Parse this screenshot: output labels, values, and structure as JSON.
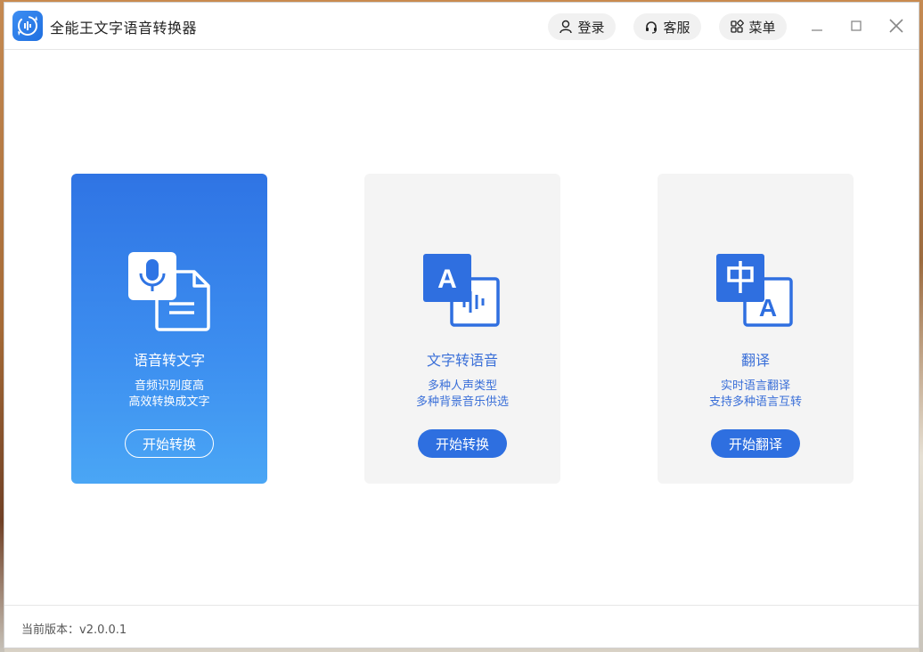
{
  "app": {
    "title": "全能王文字语音转换器",
    "logo_icon": "refresh-sound-icon",
    "accent": "#2e6fe0"
  },
  "header": {
    "login_label": "登录",
    "service_label": "客服",
    "menu_label": "菜单"
  },
  "cards": [
    {
      "title": "语音转文字",
      "desc_line1": "音频识别度高",
      "desc_line2": "高效转换成文字",
      "button": "开始转换",
      "icon": "mic-document-icon"
    },
    {
      "title": "文字转语音",
      "desc_line1": "多种人声类型",
      "desc_line2": "多种背景音乐供选",
      "button": "开始转换",
      "icon": "letter-a-waveform-icon"
    },
    {
      "title": "翻译",
      "desc_line1": "实时语言翻译",
      "desc_line2": "支持多种语言互转",
      "button": "开始翻译",
      "icon": "chinese-english-translate-icon"
    }
  ],
  "footer": {
    "version": "当前版本：v2.0.0.1"
  }
}
